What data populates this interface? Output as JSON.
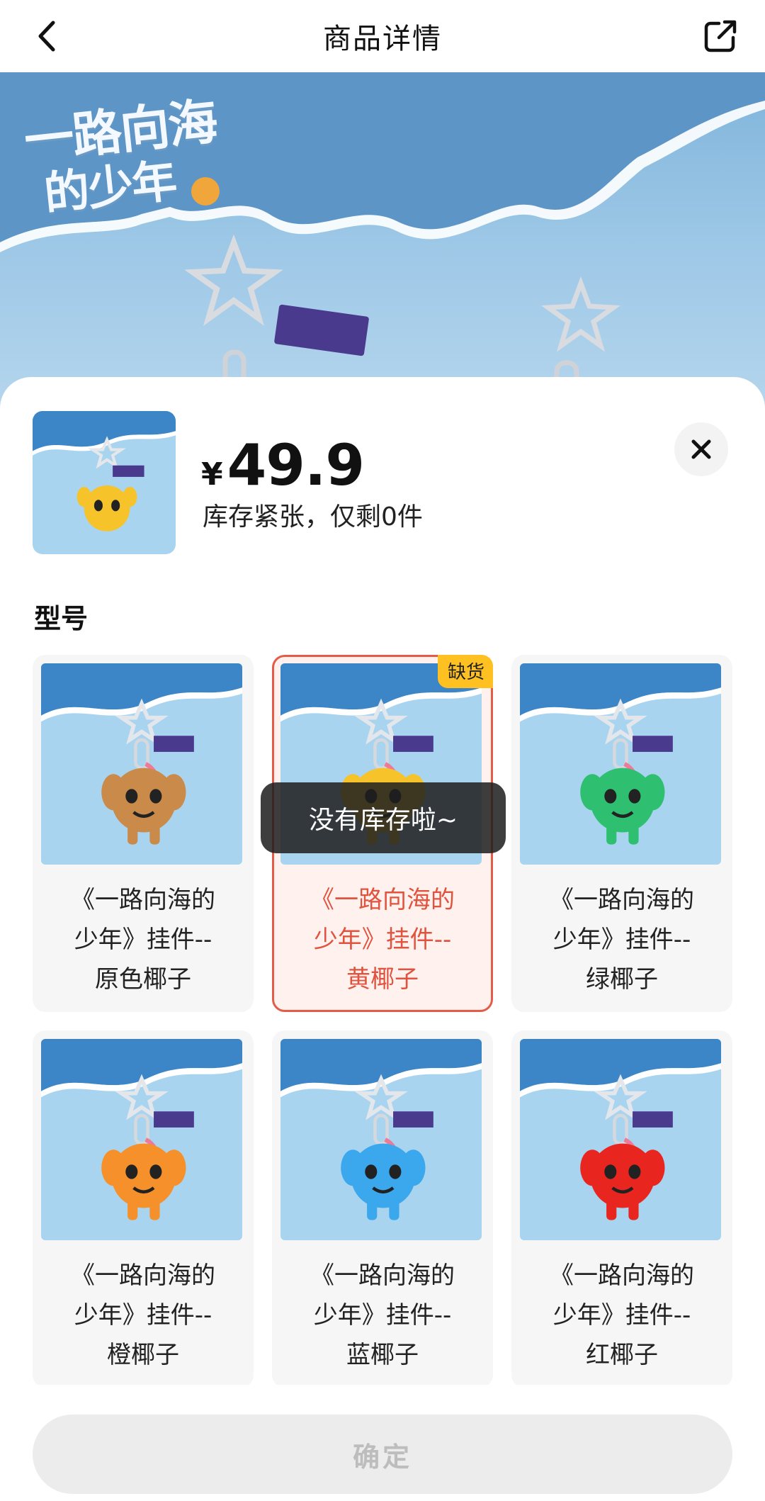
{
  "header": {
    "title": "商品详情",
    "back_icon": "chevron-left-icon",
    "share_icon": "share-icon"
  },
  "hero": {
    "logo_line1": "一路向海",
    "logo_line2": "的少年"
  },
  "sheet": {
    "price_symbol": "¥",
    "price": "49.9",
    "stock_note": "库存紧张，仅剩0件",
    "close_icon": "close-icon",
    "section_title": "型号",
    "variants": [
      {
        "name_l1": "《一路向海的",
        "name_l2": "少年》挂件--",
        "name_l3": "原色椰子",
        "color": "#c98a4a",
        "selected": false,
        "badge": ""
      },
      {
        "name_l1": "《一路向海的",
        "name_l2": "少年》挂件--",
        "name_l3": "黄椰子",
        "color": "#f6c32a",
        "selected": true,
        "badge": "缺货"
      },
      {
        "name_l1": "《一路向海的",
        "name_l2": "少年》挂件--",
        "name_l3": "绿椰子",
        "color": "#2fbf71",
        "selected": false,
        "badge": ""
      },
      {
        "name_l1": "《一路向海的",
        "name_l2": "少年》挂件--",
        "name_l3": "橙椰子",
        "color": "#f5902b",
        "selected": false,
        "badge": ""
      },
      {
        "name_l1": "《一路向海的",
        "name_l2": "少年》挂件--",
        "name_l3": "蓝椰子",
        "color": "#3ba7ec",
        "selected": false,
        "badge": ""
      },
      {
        "name_l1": "《一路向海的",
        "name_l2": "少年》挂件--",
        "name_l3": "红椰子",
        "color": "#e8261f",
        "selected": false,
        "badge": ""
      }
    ]
  },
  "toast": {
    "text": "没有库存啦~"
  },
  "footer": {
    "confirm_label": "确定"
  },
  "colors": {
    "accent": "#e45b47",
    "badge": "#ffc021",
    "sky": "#9cc7e6"
  }
}
